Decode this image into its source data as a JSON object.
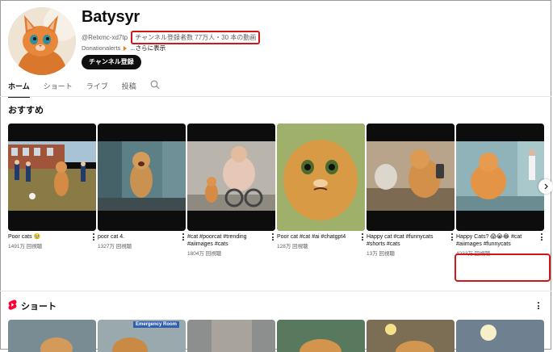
{
  "channel": {
    "name": "Batysyr",
    "handle": "@Relxmc-xd7tp",
    "stats": "チャンネル登録者数 77万人・30 本の動画",
    "links_prefix": "Donationalerts",
    "links_more": "...さらに表示",
    "subscribe_label": "チャンネル登録"
  },
  "tabs": [
    {
      "label": "ホーム"
    },
    {
      "label": "ショート"
    },
    {
      "label": "ライブ"
    },
    {
      "label": "投稿"
    }
  ],
  "sections": {
    "recommended_title": "おすすめ",
    "shorts_title": "ショート"
  },
  "videos": [
    {
      "title": "Poor cats 🥹",
      "views": "1491万 回視聴"
    },
    {
      "title": "poor cat 4.",
      "views": "1327万 回視聴"
    },
    {
      "title": "#cat #poorcat #trending #aiimages #cats",
      "views": "1804万 回視聴"
    },
    {
      "title": "Poor cat #cat #ai #chatgpt4",
      "views": "128万 回視聴"
    },
    {
      "title": "Happy cat #cat #funnycats #shorts #cats",
      "views": "13万 回視聴"
    },
    {
      "title": "Happy Cats? 😱😭😂 #cat #aiimages #funnycats",
      "views": "4233万 回視聴"
    }
  ],
  "shorts": {
    "room_sign": "Emergency Room"
  },
  "colors": {
    "highlight": "#d01616",
    "shorts_red": "#ff0033",
    "text": "#0f0f0f",
    "secondary_text": "#606060"
  }
}
